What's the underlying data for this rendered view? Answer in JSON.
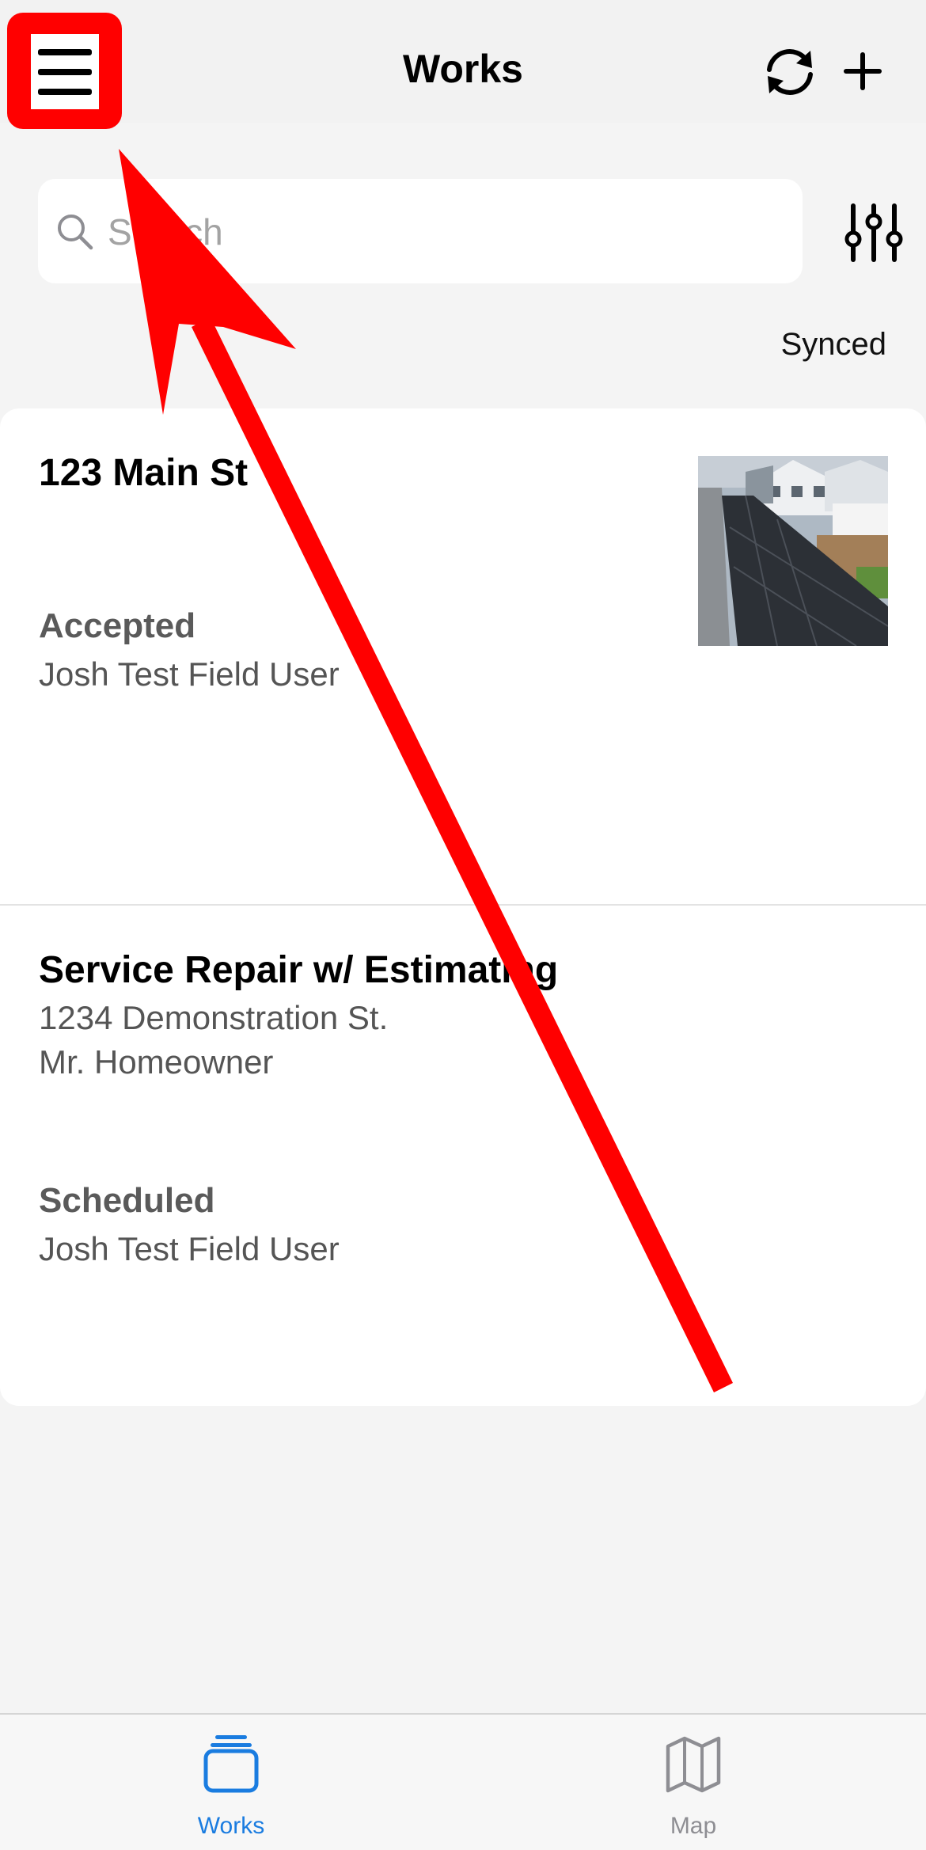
{
  "navbar": {
    "title": "Works",
    "menu_icon": "hamburger-menu-icon",
    "sync_icon": "sync-icon",
    "add_icon": "plus-icon"
  },
  "search": {
    "placeholder": "Search",
    "filter_icon": "sliders-icon"
  },
  "sync_status": "Synced",
  "works": [
    {
      "title": "123 Main St",
      "status": "Accepted",
      "assignee": "Josh Test Field User",
      "has_photo": true
    },
    {
      "title": "Service Repair w/ Estimating",
      "address": "1234 Demonstration St.",
      "customer": "Mr. Homeowner",
      "status": "Scheduled",
      "assignee": "Josh Test Field User"
    }
  ],
  "tabbar": {
    "tabs": [
      {
        "label": "Works",
        "icon": "stack-cards-icon",
        "active": true
      },
      {
        "label": "Map",
        "icon": "map-icon",
        "active": false
      }
    ]
  },
  "colors": {
    "accent": "#1a7ce0",
    "annotation": "#ff0000",
    "inactive_tab": "#8e8e93"
  }
}
